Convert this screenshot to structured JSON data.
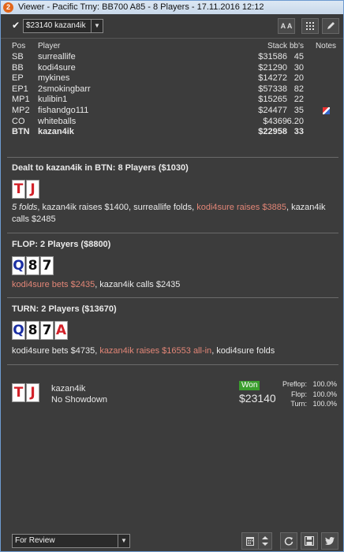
{
  "window": {
    "title": "Viewer - Pacific Trny: BB700 A85 - 8 Players - 17.11.2016 12:12",
    "app_icon": "2"
  },
  "toolbar": {
    "check_icon": "✔",
    "hand_select": "$23140 kazan4ik",
    "arrow_icon": "▼",
    "font_button": "A A",
    "grid_icon": "grid-icon",
    "edit_icon": "pencil-icon"
  },
  "table": {
    "headers": {
      "pos": "Pos",
      "player": "Player",
      "stack": "Stack",
      "bbs": "bb's",
      "notes": "Notes"
    },
    "rows": [
      {
        "pos": "SB",
        "player": "surreallife",
        "stack": "$31586",
        "bbs": "45"
      },
      {
        "pos": "BB",
        "player": "kodi4sure",
        "stack": "$21290",
        "bbs": "30"
      },
      {
        "pos": "EP",
        "player": "mykines",
        "stack": "$14272",
        "bbs": "20"
      },
      {
        "pos": "EP1",
        "player": "2smokingbarr",
        "stack": "$57338",
        "bbs": "82"
      },
      {
        "pos": "MP1",
        "player": "kulibin1",
        "stack": "$15265",
        "bbs": "22"
      },
      {
        "pos": "MP2",
        "player": "fishandgo111",
        "stack": "$24477",
        "bbs": "35"
      },
      {
        "pos": "CO",
        "player": "whiteballs",
        "stack": "$4369",
        "bbs": "6.20"
      },
      {
        "pos": "BTN",
        "player": "kazan4ik",
        "stack": "$22958",
        "bbs": "33"
      }
    ]
  },
  "preflop": {
    "title": "Dealt to kazan4ik in BTN: 8 Players ($1030)",
    "cards": [
      "T",
      "J"
    ],
    "a1": "5 folds",
    "a2": ", kazan4ik raises $1400, surreallife folds, ",
    "a3": "kodi4sure raises $3885",
    "a4": ", kazan4ik calls $2485"
  },
  "flop": {
    "title": "FLOP: 2 Players ($8800)",
    "cards": [
      "Q",
      "8",
      "7"
    ],
    "a1": "kodi4sure bets $2435",
    "a2": ", kazan4ik calls $2435"
  },
  "turn": {
    "title": "TURN: 2 Players ($13670)",
    "cards": [
      "Q",
      "8",
      "7",
      "A"
    ],
    "a1": "kodi4sure bets $4735, ",
    "a2": "kazan4ik raises $16553 all-in",
    "a3": ", kodi4sure folds"
  },
  "result": {
    "cards": [
      "T",
      "J"
    ],
    "player": "kazan4ik",
    "showdown": "No Showdown",
    "won_label": "Won",
    "amount": "$23140",
    "equity": [
      {
        "label": "Preflop:",
        "value": "100.0%"
      },
      {
        "label": "Flop:",
        "value": "100.0%"
      },
      {
        "label": "Turn:",
        "value": "100.0%"
      }
    ]
  },
  "bottom": {
    "review_select": "For Review",
    "arrow_icon": "▼"
  }
}
